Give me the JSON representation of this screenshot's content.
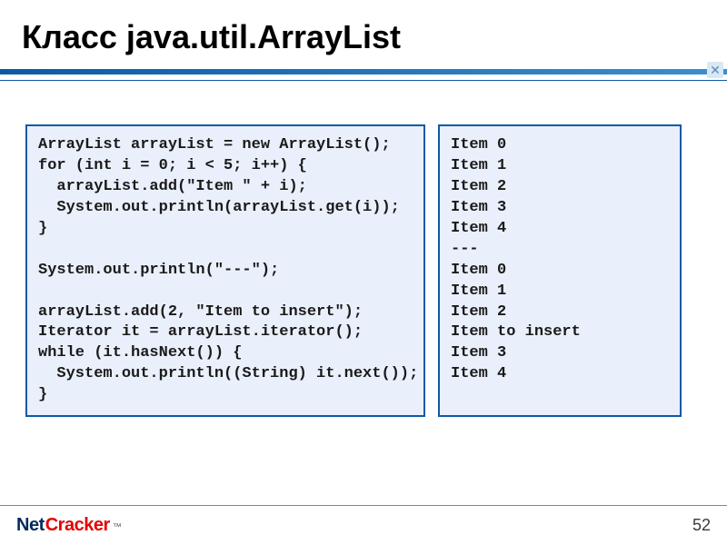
{
  "slide": {
    "title": "Класс java.util.ArrayList",
    "page_number": "52"
  },
  "code": {
    "left": "ArrayList arrayList = new ArrayList();\nfor (int i = 0; i < 5; i++) {\n  arrayList.add(\"Item \" + i);\n  System.out.println(arrayList.get(i));\n}\n\nSystem.out.println(\"---\");\n\narrayList.add(2, \"Item to insert\");\nIterator it = arrayList.iterator();\nwhile (it.hasNext()) {\n  System.out.println((String) it.next());\n}",
    "right": "Item 0\nItem 1\nItem 2\nItem 3\nItem 4\n---\nItem 0\nItem 1\nItem 2\nItem to insert\nItem 3\nItem 4"
  },
  "footer": {
    "logo_net": "Net",
    "logo_cracker": "Cracker",
    "logo_tm": "™"
  }
}
